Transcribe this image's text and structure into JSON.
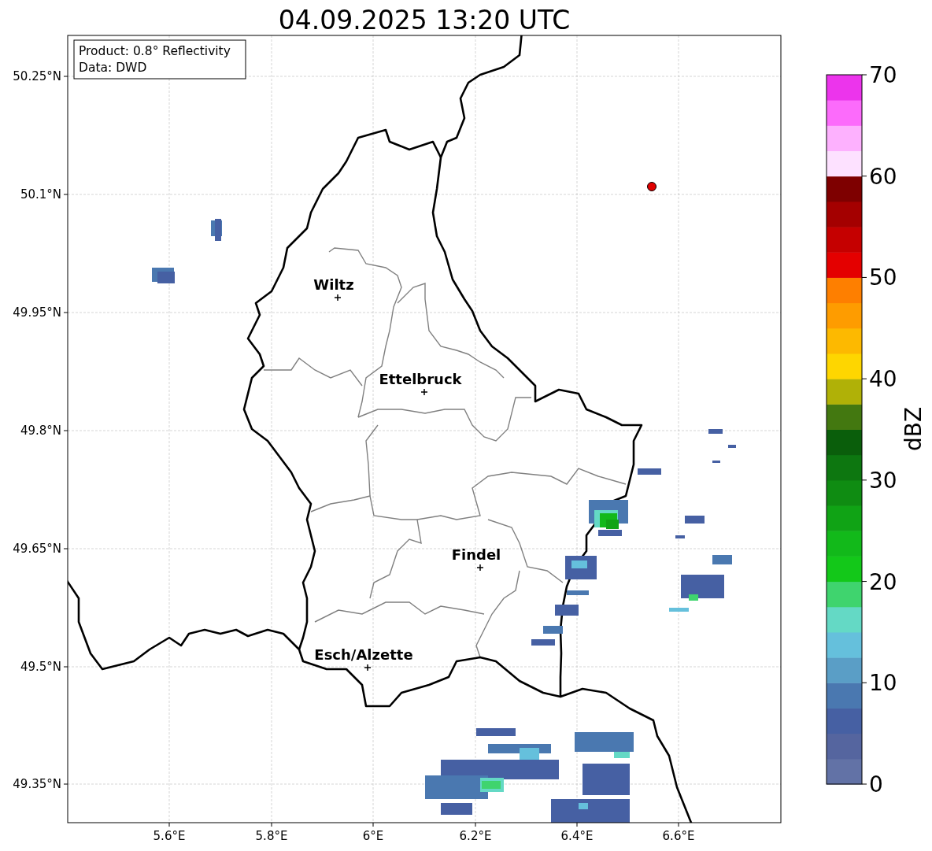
{
  "title": "04.09.2025 13:20 UTC",
  "info_box": [
    "Product: 0.8° Reflectivity",
    "Data: DWD"
  ],
  "y_ticks": [
    "50.25°N",
    "50.1°N",
    "49.95°N",
    "49.8°N",
    "49.65°N",
    "49.5°N",
    "49.35°N"
  ],
  "x_ticks": [
    "5.6°E",
    "5.8°E",
    "6°E",
    "6.2°E",
    "6.4°E",
    "6.6°E"
  ],
  "cities": [
    {
      "name": "Wiltz"
    },
    {
      "name": "Ettelbruck"
    },
    {
      "name": "Findel"
    },
    {
      "name": "Esch/Alzette"
    }
  ],
  "colorbar": {
    "label": "dBZ",
    "ticks": [
      "70",
      "60",
      "50",
      "40",
      "30",
      "20",
      "10",
      "0"
    ],
    "bins": [
      {
        "color": "#6272a6"
      },
      {
        "color": "#55659f"
      },
      {
        "color": "#4660a3"
      },
      {
        "color": "#4a78b0"
      },
      {
        "color": "#5a9ec6"
      },
      {
        "color": "#65c0dc"
      },
      {
        "color": "#64d9c5"
      },
      {
        "color": "#3fd46e"
      },
      {
        "color": "#13c819"
      },
      {
        "color": "#12b91a"
      },
      {
        "color": "#10a315"
      },
      {
        "color": "#0f8c12"
      },
      {
        "color": "#0d7710"
      },
      {
        "color": "#0a5e0b"
      },
      {
        "color": "#437810"
      },
      {
        "color": "#b0b107"
      },
      {
        "color": "#fed600"
      },
      {
        "color": "#fdb900"
      },
      {
        "color": "#fe9c00"
      },
      {
        "color": "#fe7f00"
      },
      {
        "color": "#e40000"
      },
      {
        "color": "#c50000"
      },
      {
        "color": "#a40000"
      },
      {
        "color": "#7e0000"
      },
      {
        "color": "#fde1ff"
      },
      {
        "color": "#fdb1fe"
      },
      {
        "color": "#fc6bfb"
      },
      {
        "color": "#ec34ec"
      }
    ]
  }
}
